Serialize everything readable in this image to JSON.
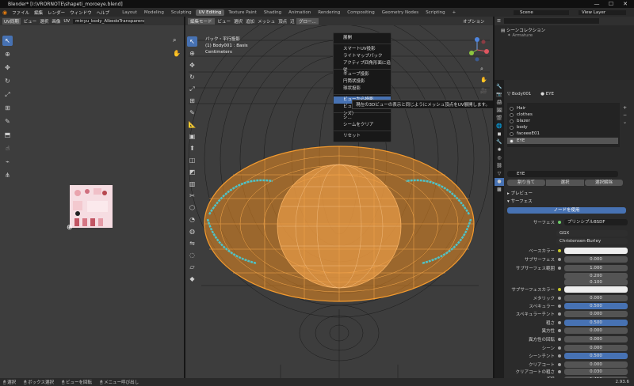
{
  "window": {
    "title": "Blender* [I:\\VRORNOTE\\shapeti_moroeye.blend]",
    "min": "—",
    "max": "☐",
    "close": "✕"
  },
  "menus": [
    "ファイル",
    "編集",
    "レンダー",
    "ウィンドウ",
    "ヘルプ"
  ],
  "workspaces": [
    "Layout",
    "Modeling",
    "Sculpting",
    "UV Editing",
    "Texture Paint",
    "Shading",
    "Animation",
    "Rendering",
    "Compositing",
    "Geometry Nodes",
    "Scripting"
  ],
  "add_tab": "+",
  "scene": {
    "label": "Scene",
    "view_layer": "View Layer"
  },
  "uv_editor": {
    "mode": "UV同期",
    "menus": [
      "ビュー",
      "選択",
      "画像",
      "UV"
    ],
    "image_name": "minyu_body_AlbedoTransparency.png.0"
  },
  "viewport": {
    "header": [
      "編集モード",
      "ビュー",
      "選択",
      "追加",
      "メッシュ",
      "頂点",
      "辺",
      "面",
      "UV"
    ],
    "uv_menu_label": "UV",
    "transform": "グロー...",
    "options_label": "オプション",
    "info_line1": "バック・平行投影",
    "info_line2": "(1) Body001 : Basis",
    "info_line3": "Centimeters"
  },
  "uv_menu": {
    "items": [
      {
        "label": "展開",
        "hl": false
      },
      {
        "sep": true
      },
      {
        "label": "スマートUV投影",
        "hl": false
      },
      {
        "label": "ライトマップパック",
        "hl": false
      },
      {
        "label": "アクティブ四角形面に追従",
        "hl": false
      },
      {
        "sep": true
      },
      {
        "label": "キューブ投影",
        "hl": false
      },
      {
        "label": "円筒状投影",
        "hl": false
      },
      {
        "label": "球状投影",
        "hl": false
      },
      {
        "sep": true
      },
      {
        "label": "ビューから投影",
        "hl": true
      },
      {
        "label": "ビューから投影（バウンズ）",
        "hl": false
      },
      {
        "sep": true
      },
      {
        "label": "シ...",
        "hl": false
      },
      {
        "label": "シームをクリア",
        "hl": false
      },
      {
        "sep": true
      },
      {
        "label": "リセット",
        "hl": false
      }
    ],
    "tooltip": "現在の3Dビューの表示と同じようにメッシュ頂点をUV展開します。"
  },
  "outliner": {
    "collection": "シーンコレクション",
    "armature": "Armature"
  },
  "properties": {
    "object": "Body001",
    "material_slot": "EYE",
    "materials": [
      "Hair",
      "clothes",
      "blazer",
      "body",
      "faceeeE01",
      "EYE"
    ],
    "mat_name": "EYE",
    "assign": "割り当て",
    "select": "選択",
    "deselect": "選択解除",
    "preview": "プレビュー",
    "surface": "サーフェス",
    "use_nodes": "ノードを使用",
    "surface_label": "サーフェス",
    "surface_value": "プリンシプルBSDF",
    "distribution": "GGX",
    "subsurface_method": "Christensen-Burley",
    "rows": [
      {
        "label": "ベースカラー",
        "value": "",
        "type": "color"
      },
      {
        "label": "サブサーフェス",
        "value": "0.000",
        "type": "num"
      },
      {
        "label": "サブサーフェス範囲",
        "value": "1.000",
        "type": "num"
      },
      {
        "label": "",
        "value": "0.200",
        "type": "num"
      },
      {
        "label": "",
        "value": "0.100",
        "type": "num"
      },
      {
        "label": "サブサーフェスカラー",
        "value": "",
        "type": "color"
      },
      {
        "label": "メタリック",
        "value": "0.000",
        "type": "num"
      },
      {
        "label": "スペキュラー",
        "value": "0.500",
        "type": "blue"
      },
      {
        "label": "スペキュラーチント",
        "value": "0.000",
        "type": "num"
      },
      {
        "label": "粗さ",
        "value": "0.500",
        "type": "blue"
      },
      {
        "label": "異方性",
        "value": "0.000",
        "type": "num"
      },
      {
        "label": "異方性の回転",
        "value": "0.000",
        "type": "num"
      },
      {
        "label": "シーン",
        "value": "0.000",
        "type": "num"
      },
      {
        "label": "シーンチント",
        "value": "0.500",
        "type": "blue"
      },
      {
        "label": "クリアコート",
        "value": "0.000",
        "type": "num"
      },
      {
        "label": "クリアコートの粗さ",
        "value": "0.030",
        "type": "num"
      },
      {
        "label": "IOR",
        "value": "1.450",
        "type": "num"
      }
    ]
  },
  "statusbar": {
    "select": "選択",
    "box": "ボックス選択",
    "rotate": "ビューを回転",
    "menu": "メニュー呼び出し",
    "version": "2.93.6"
  },
  "colors": {
    "accent": "#4772b3",
    "selection": "#f39a2e",
    "wire": "#1a1a1a"
  }
}
